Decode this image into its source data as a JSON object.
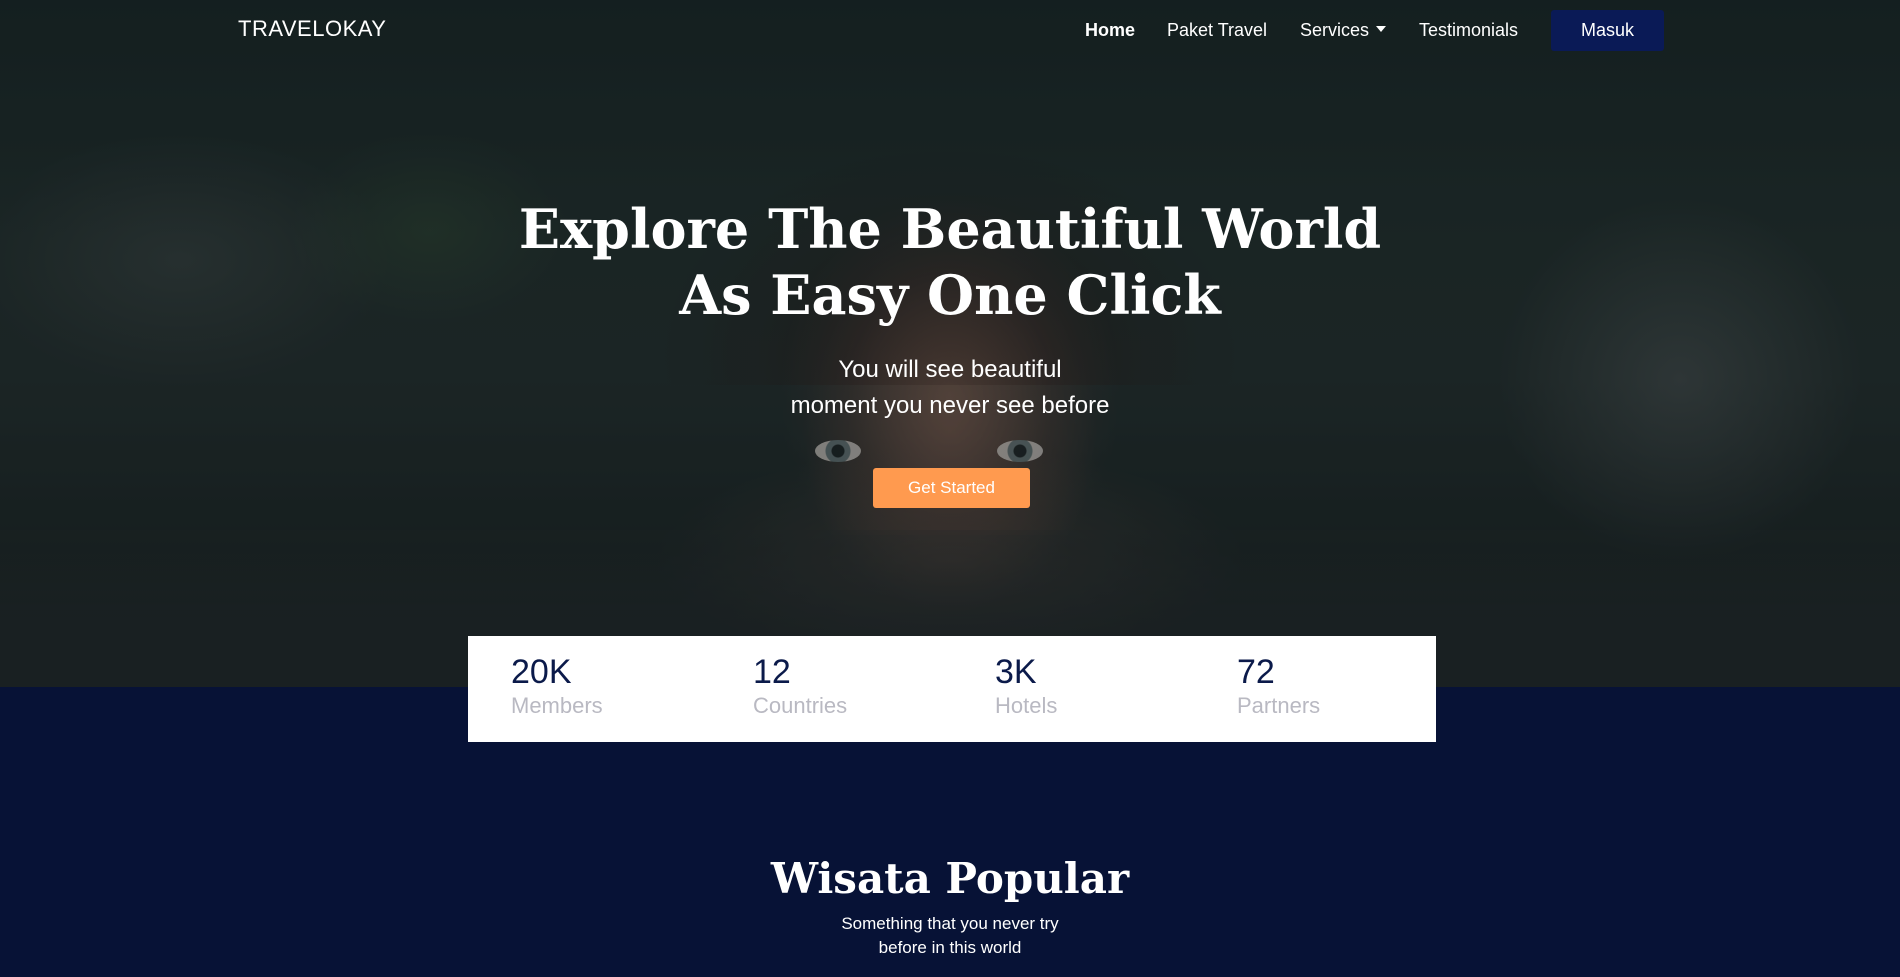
{
  "navbar": {
    "brand": "TRAVELOKAY",
    "items": [
      {
        "label": "Home",
        "active": true
      },
      {
        "label": "Paket Travel"
      },
      {
        "label": "Services",
        "dropdown": true
      },
      {
        "label": "Testimonials"
      }
    ],
    "login_button": "Masuk"
  },
  "hero": {
    "title_line1": "Explore The Beautiful World",
    "title_line2": "As Easy One Click",
    "subtitle_line1": "You will see beautiful",
    "subtitle_line2": "moment you never see before",
    "cta_label": "Get Started"
  },
  "stats": [
    {
      "value": "20K",
      "label": "Members"
    },
    {
      "value": "12",
      "label": "Countries"
    },
    {
      "value": "3K",
      "label": "Hotels"
    },
    {
      "value": "72",
      "label": "Partners"
    }
  ],
  "popular": {
    "title": "Wisata Popular",
    "subtitle_line1": "Something that you never try",
    "subtitle_line2": "before in this world"
  },
  "colors": {
    "navy": "#071236",
    "button_navy": "#0a1a56",
    "accent_orange": "#ff9a4f",
    "stat_value": "#0b1a4a",
    "stat_label": "#b9b9c2"
  }
}
